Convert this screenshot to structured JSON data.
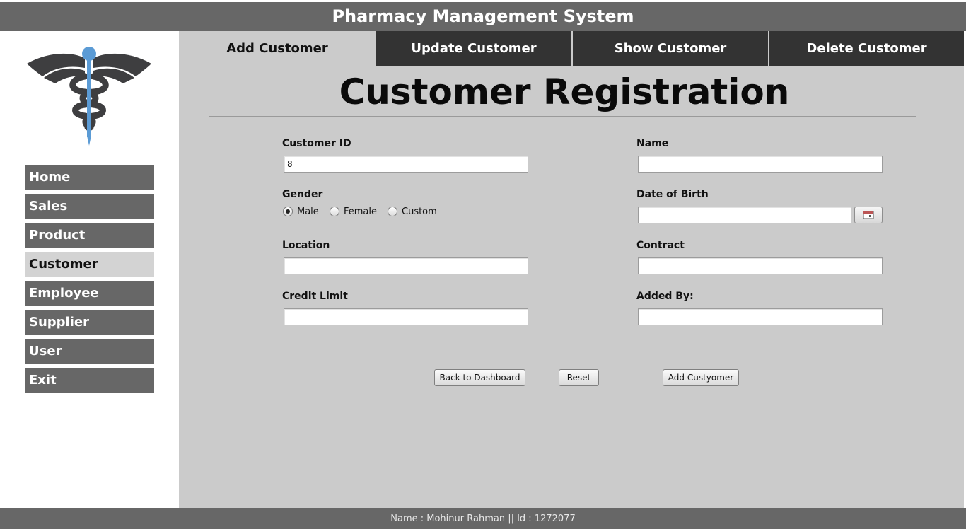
{
  "app": {
    "title": "Pharmacy Management System"
  },
  "sidebar": {
    "items": [
      {
        "label": "Home"
      },
      {
        "label": "Sales"
      },
      {
        "label": "Product"
      },
      {
        "label": "Customer",
        "active": true
      },
      {
        "label": "Employee"
      },
      {
        "label": "Supplier"
      },
      {
        "label": "User"
      },
      {
        "label": "Exit"
      }
    ]
  },
  "tabs": [
    {
      "label": "Add Customer",
      "active": true
    },
    {
      "label": "Update Customer"
    },
    {
      "label": "Show Customer"
    },
    {
      "label": "Delete Customer"
    }
  ],
  "form": {
    "heading": "Customer Registration",
    "customer_id": {
      "label": "Customer ID",
      "value": "8"
    },
    "name": {
      "label": "Name",
      "value": ""
    },
    "gender": {
      "label": "Gender",
      "options": [
        "Male",
        "Female",
        "Custom"
      ],
      "selected": "Male"
    },
    "dob": {
      "label": "Date of Birth",
      "value": ""
    },
    "location": {
      "label": "Location",
      "value": ""
    },
    "contract": {
      "label": "Contract",
      "value": ""
    },
    "credit_limit": {
      "label": "Credit Limit",
      "value": ""
    },
    "added_by": {
      "label": "Added By:",
      "value": ""
    }
  },
  "buttons": {
    "back": "Back to Dashboard",
    "reset": "Reset",
    "add": "Add Custyomer"
  },
  "footer": {
    "text": "Name : Mohinur Rahman || Id : 1272077"
  },
  "colors": {
    "bar": "#676767",
    "main_bg": "#cbcbcb",
    "tab_dark": "#333333",
    "logo_dark": "#3e3e40",
    "logo_blue": "#5b9bd5"
  },
  "icons": {
    "logo": "caduceus-logo",
    "calendar": "calendar-icon"
  }
}
